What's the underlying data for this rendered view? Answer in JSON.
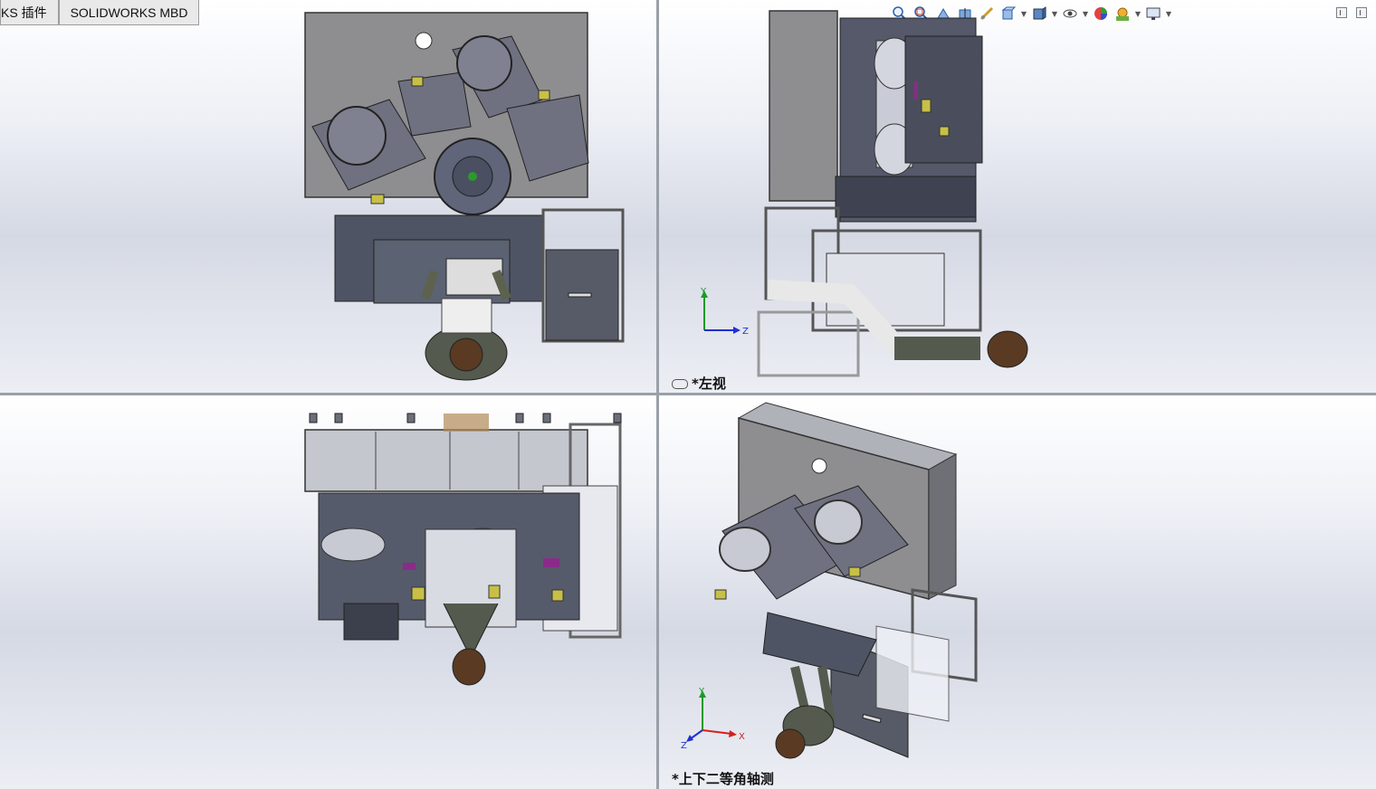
{
  "tabs": {
    "addins_label": "KS 插件",
    "mbd_label": "SOLIDWORKS MBD"
  },
  "heads_up_toolbar": {
    "icons": [
      "zoom-to-fit-icon",
      "zoom-to-area-icon",
      "previous-view-icon",
      "section-view-icon",
      "dynamic-annotation-icon",
      "view-orientation-icon",
      "display-style-icon",
      "hide-show-items-icon",
      "edit-appearance-icon",
      "apply-scene-icon",
      "view-settings-icon"
    ]
  },
  "viewports": {
    "top_left": {
      "label": ""
    },
    "top_right": {
      "label": "*左视",
      "triad_axes": [
        "Y",
        "Z"
      ]
    },
    "bottom_left": {
      "label": ""
    },
    "bottom_right": {
      "label": "*上下二等角轴测",
      "triad_axes": [
        "Y",
        "Z",
        "X"
      ]
    }
  },
  "colors": {
    "panel_gray": "#8e8e91",
    "steel_dark": "#4e5463",
    "triad_x": "#d42020",
    "triad_y": "#1a9a2a",
    "triad_z": "#2030d0"
  }
}
